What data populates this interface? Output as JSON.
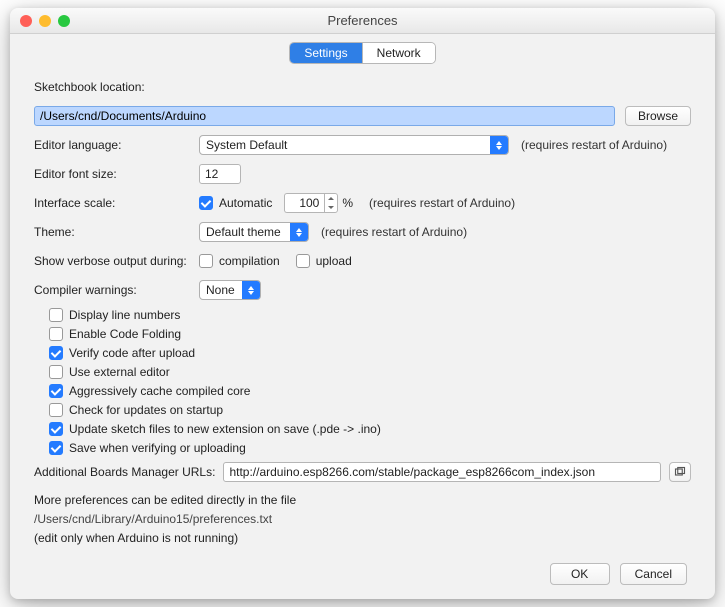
{
  "window": {
    "title": "Preferences"
  },
  "tabs": {
    "settings": "Settings",
    "network": "Network"
  },
  "labels": {
    "sketchbook": "Sketchbook location:",
    "editor_lang": "Editor language:",
    "font_size": "Editor font size:",
    "iface_scale": "Interface scale:",
    "theme": "Theme:",
    "verbose": "Show verbose output during:",
    "compiler_warn": "Compiler warnings:",
    "boards_url": "Additional Boards Manager URLs:"
  },
  "values": {
    "sketchbook_path": "/Users/cnd/Documents/Arduino",
    "editor_lang": "System Default",
    "font_size": "12",
    "iface_scale": "100",
    "theme": "Default theme",
    "compiler_warn": "None",
    "boards_url": "http://arduino.esp8266.com/stable/package_esp8266com_index.json"
  },
  "buttons": {
    "browse": "Browse",
    "ok": "OK",
    "cancel": "Cancel"
  },
  "hints": {
    "restart1": "(requires restart of Arduino)",
    "restart2": "(requires restart of Arduino)",
    "restart3": "(requires restart of Arduino)",
    "percent": "%"
  },
  "inline_checks": {
    "automatic": "Automatic",
    "compilation": "compilation",
    "upload": "upload"
  },
  "checks": [
    {
      "label": "Display line numbers",
      "checked": false
    },
    {
      "label": "Enable Code Folding",
      "checked": false
    },
    {
      "label": "Verify code after upload",
      "checked": true
    },
    {
      "label": "Use external editor",
      "checked": false
    },
    {
      "label": "Aggressively cache compiled core",
      "checked": true
    },
    {
      "label": "Check for updates on startup",
      "checked": false
    },
    {
      "label": "Update sketch files to new extension on save (.pde -> .ino)",
      "checked": true
    },
    {
      "label": "Save when verifying or uploading",
      "checked": true
    }
  ],
  "footer": {
    "line1": "More preferences can be edited directly in the file",
    "path": "/Users/cnd/Library/Arduino15/preferences.txt",
    "line3": "(edit only when Arduino is not running)"
  }
}
